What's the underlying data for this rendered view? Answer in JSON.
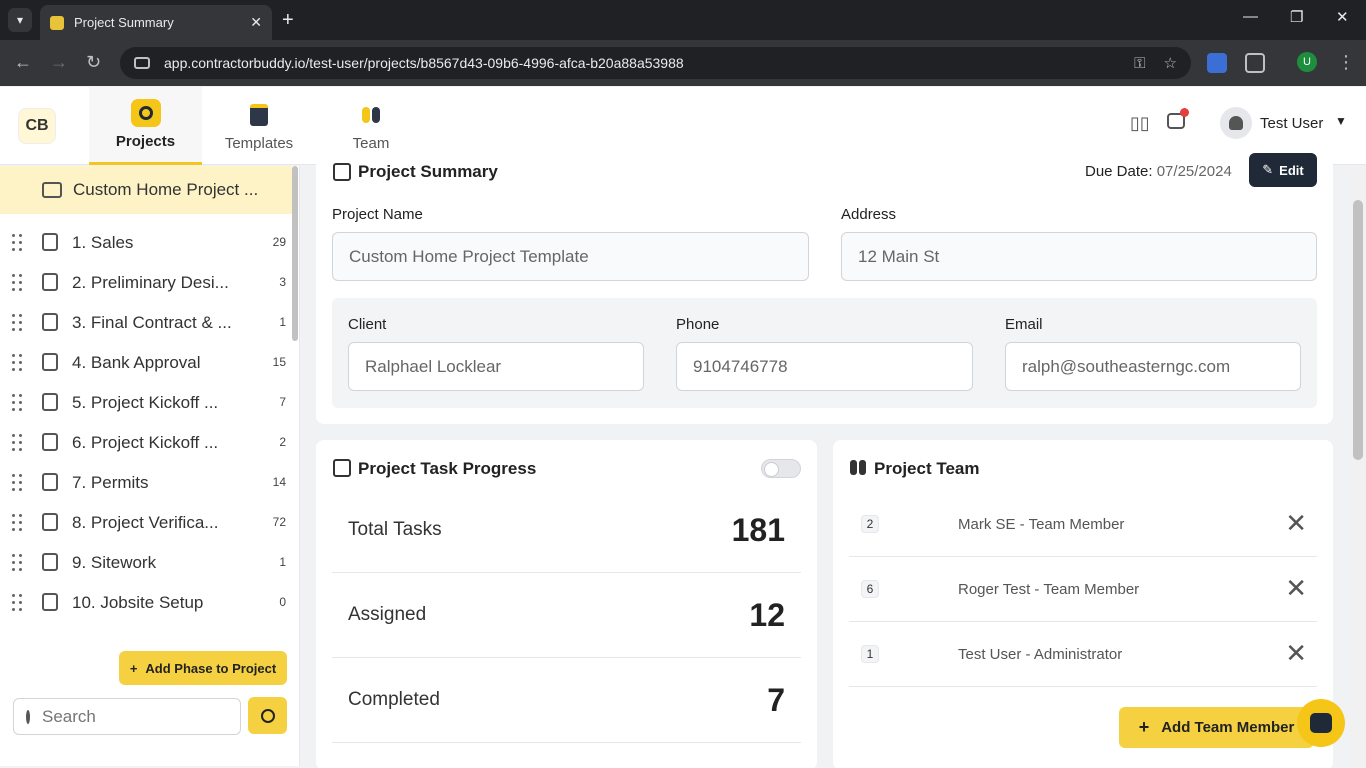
{
  "browser": {
    "tab_title": "Project Summary",
    "url": "app.contractorbuddy.io/test-user/projects/b8567d43-09b6-4996-afca-b20a88a53988",
    "profile_initial": "U"
  },
  "app": {
    "logo_text": "CB",
    "nav": [
      {
        "label": "Projects"
      },
      {
        "label": "Templates"
      },
      {
        "label": "Team"
      }
    ],
    "user_name": "Test User"
  },
  "sidebar": {
    "project_title": "Custom Home Project ...",
    "phases": [
      {
        "label": "1. Sales",
        "count": "29"
      },
      {
        "label": "2. Preliminary Desi...",
        "count": "3"
      },
      {
        "label": "3. Final Contract & ...",
        "count": "1"
      },
      {
        "label": "4. Bank Approval",
        "count": "15"
      },
      {
        "label": "5. Project Kickoff ...",
        "count": "7"
      },
      {
        "label": "6. Project Kickoff ...",
        "count": "2"
      },
      {
        "label": "7. Permits",
        "count": "14"
      },
      {
        "label": "8. Project Verifica...",
        "count": "72"
      },
      {
        "label": "9. Sitework",
        "count": "1"
      },
      {
        "label": "10. Jobsite Setup",
        "count": "0"
      }
    ],
    "add_phase_label": "Add Phase to Project",
    "search_placeholder": "Search"
  },
  "summary": {
    "title": "Project Summary",
    "due_label": "Due Date:",
    "due_value": "07/25/2024",
    "edit_label": "Edit",
    "project_name_label": "Project Name",
    "project_name_value": "Custom Home Project Template",
    "address_label": "Address",
    "address_value": "12 Main St",
    "client_label": "Client",
    "client_value": "Ralphael Locklear",
    "phone_label": "Phone",
    "phone_value": "9104746778",
    "email_label": "Email",
    "email_value": "ralph@southeasterngc.com"
  },
  "progress": {
    "title": "Project Task Progress",
    "stats": [
      {
        "label": "Total Tasks",
        "value": "181"
      },
      {
        "label": "Assigned",
        "value": "12"
      },
      {
        "label": "Completed",
        "value": "7"
      }
    ]
  },
  "team": {
    "title": "Project Team",
    "members": [
      {
        "num": "2",
        "name": "Mark SE - Team Member"
      },
      {
        "num": "6",
        "name": "Roger Test - Team Member"
      },
      {
        "num": "1",
        "name": "Test User - Administrator"
      }
    ],
    "add_label": "Add Team Member"
  },
  "colors": {
    "accent": "#f5d142",
    "dark_button": "#1f2937",
    "sidebar_highlight": "#fdf3c7"
  }
}
